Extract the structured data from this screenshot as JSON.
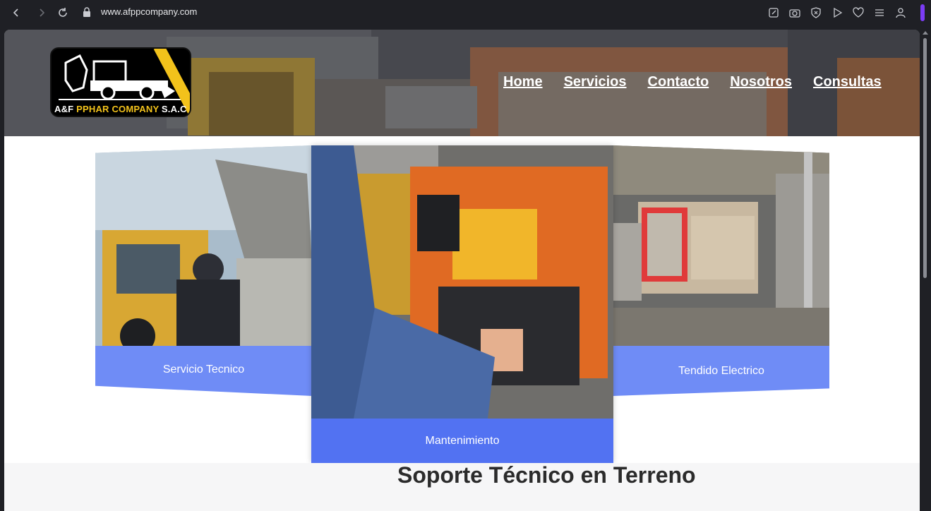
{
  "browser": {
    "url": "www.afppcompany.com",
    "icons": [
      "back-icon",
      "forward-icon",
      "reload-icon",
      "lock-icon",
      "edit-icon",
      "camera-icon",
      "shield-icon",
      "play-icon",
      "heart-icon",
      "menu-icon",
      "profile-icon"
    ]
  },
  "header": {
    "logo_text_1": "A&F ",
    "logo_text_2": "PPHAR COMPANY",
    "logo_text_3": " S.A.C",
    "nav": [
      "Home",
      "Servicios",
      "Contacto",
      "Nosotros",
      "Consultas"
    ]
  },
  "cards": {
    "left_label": "Servicio Tecnico",
    "center_label": "Mantenimiento",
    "right_label": "Tendido Electrico"
  },
  "section": {
    "title": "Soporte Técnico en Terreno"
  },
  "colors": {
    "card_label": "#6f8cf6",
    "card_center_label": "#5272f2",
    "logo_accent": "#f2c21b",
    "browser_bg": "#1f2025"
  }
}
